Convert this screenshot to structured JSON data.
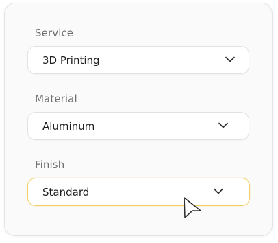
{
  "form": {
    "fields": [
      {
        "label": "Service",
        "value": "3D Printing"
      },
      {
        "label": "Material",
        "value": "Aluminum"
      },
      {
        "label": "Finish",
        "value": "Standard"
      }
    ]
  },
  "colors": {
    "active_border": "#f0cf63",
    "card_background": "#fafafa"
  },
  "icons": {
    "dropdown": "chevron-down-icon",
    "pointer": "mouse-cursor-icon"
  }
}
